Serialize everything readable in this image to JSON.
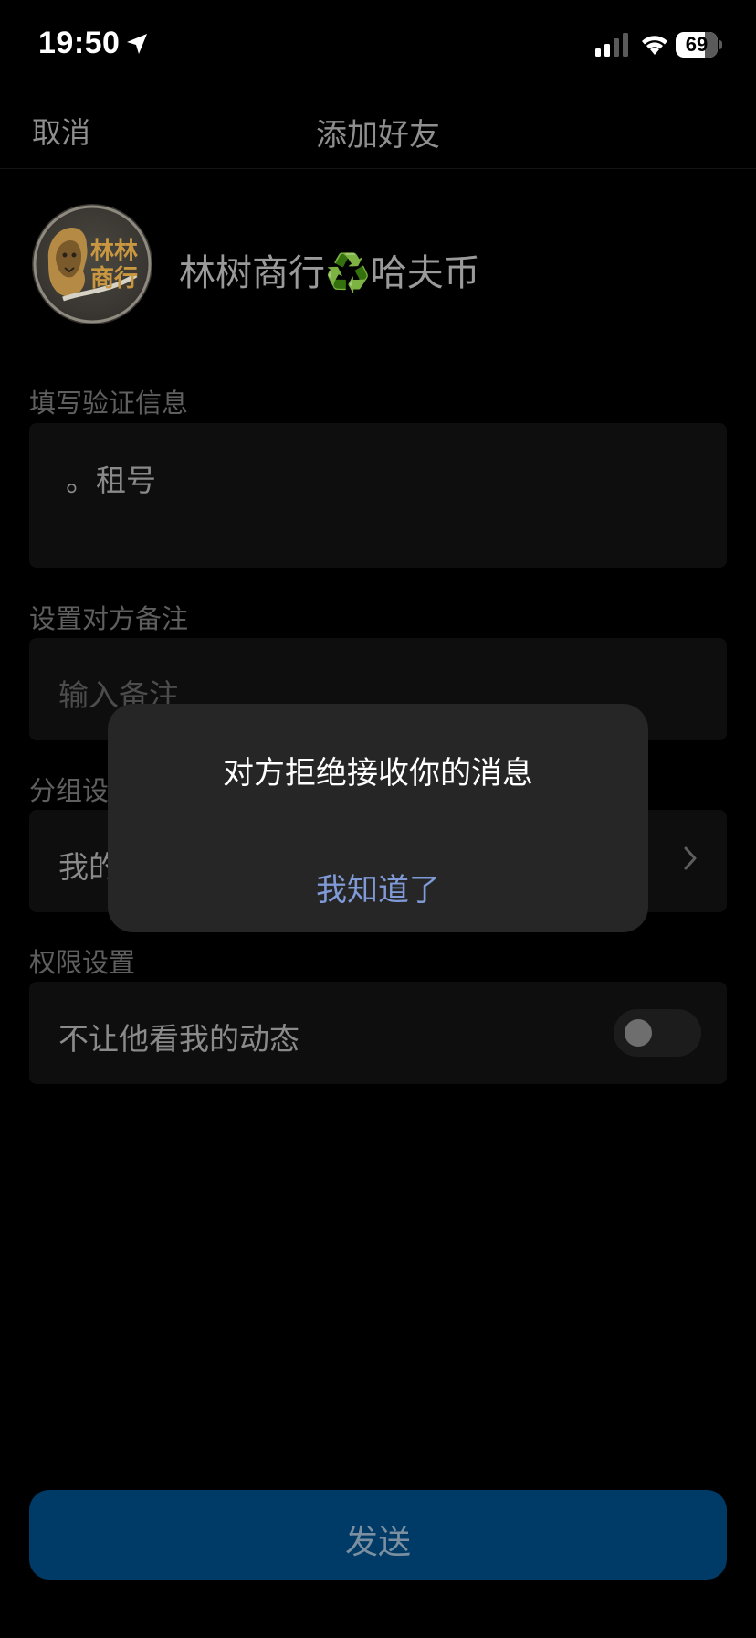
{
  "status_bar": {
    "time": "19:50",
    "battery": "69",
    "battery_level_percent": 69,
    "icons": [
      "location-arrow-icon",
      "cellular-signal-icon",
      "wifi-icon",
      "battery-icon"
    ]
  },
  "nav": {
    "cancel_label": "取消",
    "title": "添加好友"
  },
  "profile": {
    "name": "林树商行♻️哈夫币",
    "avatar_text": "林林商行"
  },
  "verification": {
    "label": "填写验证信息",
    "value": "。租号"
  },
  "remark": {
    "label": "设置对方备注",
    "placeholder": "输入备注"
  },
  "group": {
    "label": "分组设",
    "value": "我的"
  },
  "permissions": {
    "label": "权限设置",
    "hide_moments_label": "不让他看我的动态",
    "hide_moments_enabled": false
  },
  "send_label": "发送",
  "alert": {
    "message": "对方拒绝接收你的消息",
    "button_label": "我知道了"
  },
  "colors": {
    "background": "#000000",
    "send_button": "#003a66",
    "alert_button_text": "#7f9ad6"
  }
}
